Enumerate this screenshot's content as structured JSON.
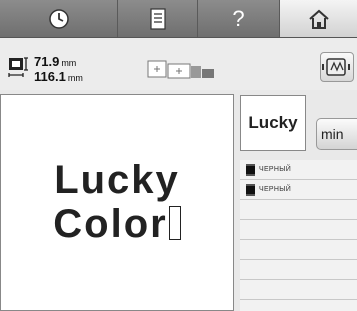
{
  "toolbar": {
    "items": [
      {
        "icon": "sewing-clock-icon"
      },
      {
        "icon": "document-icon"
      },
      {
        "label": "?",
        "icon": "help-icon"
      },
      {
        "icon": "home-icon"
      }
    ]
  },
  "size": {
    "height_value": "71.9",
    "width_value": "116.1",
    "unit": "mm"
  },
  "preview": {
    "line1": "Lucky",
    "line2": "Color"
  },
  "thumbnail": {
    "text": "Lucky"
  },
  "min_button": {
    "label": "min"
  },
  "colors": [
    {
      "name": "ЧЕРНЫЙ",
      "hex": "#111111"
    },
    {
      "name": "ЧЕРНЫЙ",
      "hex": "#111111"
    }
  ]
}
